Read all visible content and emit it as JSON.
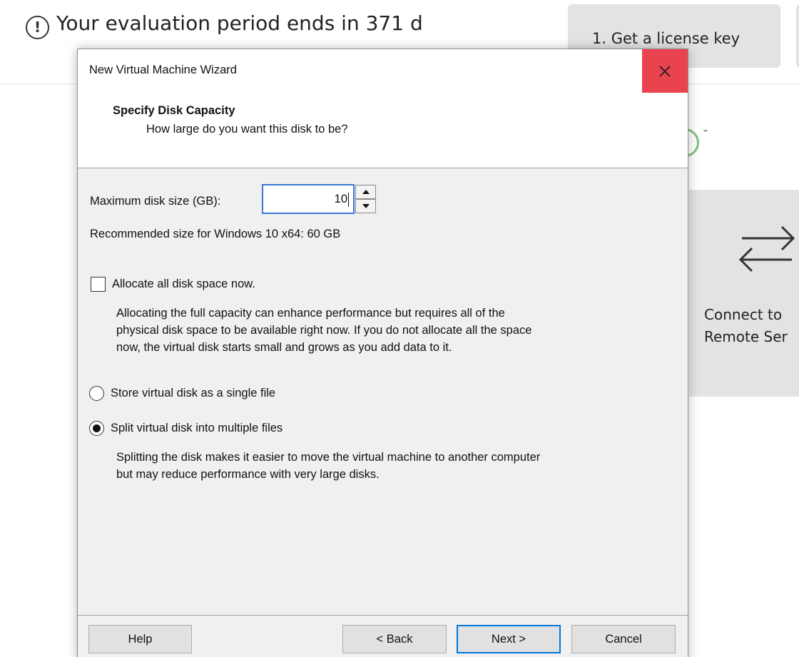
{
  "background": {
    "banner_text": "Your evaluation period ends in 371 d",
    "banner_icon": "exclamation-circle-icon",
    "license_button": "1. Get a license key",
    "connect_tile": {
      "icon": "swap-arrows-icon",
      "line1": "Connect to",
      "line2": "Remote Ser"
    },
    "trademark": "™"
  },
  "dialog": {
    "title": "New Virtual Machine Wizard",
    "close_icon": "close-icon",
    "step_title": "Specify Disk Capacity",
    "step_subtitle": "How large do you want this disk to be?",
    "max_disk_label": "Maximum disk size (GB):",
    "max_disk_value": "10",
    "recommended": "Recommended size for Windows 10 x64: 60 GB",
    "allocate_label": "Allocate all disk space now.",
    "allocate_checked": false,
    "allocate_desc": [
      "Allocating the full capacity can enhance performance but requires all of the",
      "physical disk space to be available right now. If you do not allocate all the space",
      "now, the virtual disk starts small and grows as you add data to it."
    ],
    "radio_single_label": "Store virtual disk as a single file",
    "radio_split_label": "Split virtual disk into multiple files",
    "selected_option": "split",
    "split_desc": [
      "Splitting the disk makes it easier to move the virtual machine to another computer",
      "but may reduce performance with very large disks."
    ],
    "buttons": {
      "help": "Help",
      "back": "< Back",
      "next": "Next >",
      "cancel": "Cancel"
    }
  },
  "colors": {
    "close_bg": "#e8434f",
    "focus_blue": "#0078d7",
    "dialog_bg": "#f0f0f0",
    "tile_bg": "#e3e3e3"
  }
}
